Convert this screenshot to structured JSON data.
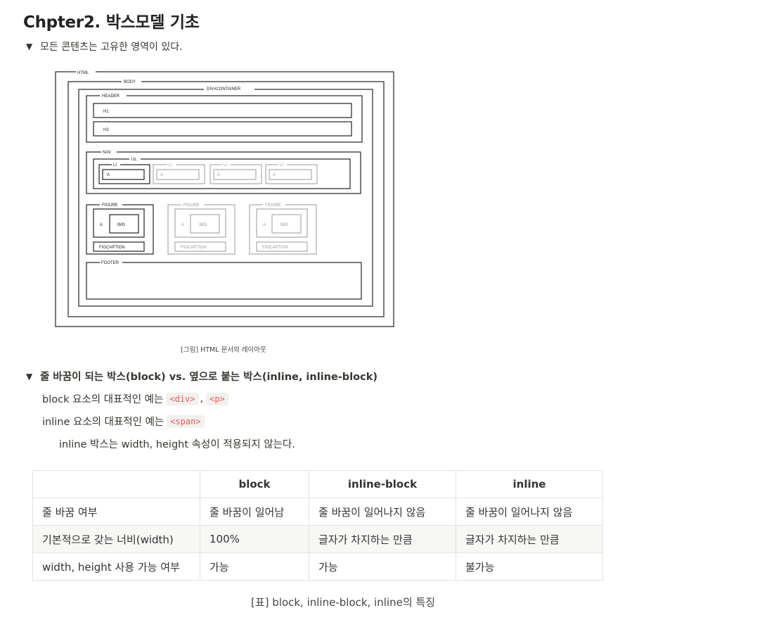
{
  "title": "Chpter2. 박스모델 기초",
  "toggles": [
    {
      "label": "모든 콘텐츠는 고유한 영역이 있다."
    },
    {
      "label": "줄 바꿈이 되는 박스(block) vs. 옆으로 붙는 박스(inline, inline-block)"
    }
  ],
  "diagram": {
    "labels": {
      "html": "HTML",
      "body": "BODY",
      "container": "DIV#CONTAINER",
      "header": "HEADER",
      "h1": "H1",
      "h2": "H2",
      "nav": "NAV",
      "ul": "UL",
      "li": "LI",
      "a": "A",
      "figure": "FIGURE",
      "img": "IMG",
      "figcaption": "FIGCAPTION",
      "footer": "FOOTER"
    },
    "caption": "[그림] HTML 문서의 레이아웃"
  },
  "lines": {
    "block_text": "block 요소의 대표적인 예는",
    "block_tags": [
      "<div>",
      "<p>"
    ],
    "inline_text": "inline 요소의 대표적인 예는",
    "inline_tag": "<span>",
    "note": "inline 박스는 width, height 속성이 적용되지 않는다."
  },
  "table": {
    "headers": [
      "",
      "block",
      "inline-block",
      "inline"
    ],
    "rows": [
      [
        "줄 바꿈 여부",
        "줄 바꿈이 일어남",
        "줄 바꿈이 일어나지 않음",
        "줄 바꿈이 일어나지 않음"
      ],
      [
        "기본적으로 갖는 너비(width)",
        "100%",
        "글자가 차지하는 만큼",
        "글자가 차지하는 만큼"
      ],
      [
        "width, height 사용 가능 여부",
        "가능",
        "가능",
        "불가능"
      ]
    ],
    "caption": "[표] block, inline-block, inline의 특징"
  }
}
